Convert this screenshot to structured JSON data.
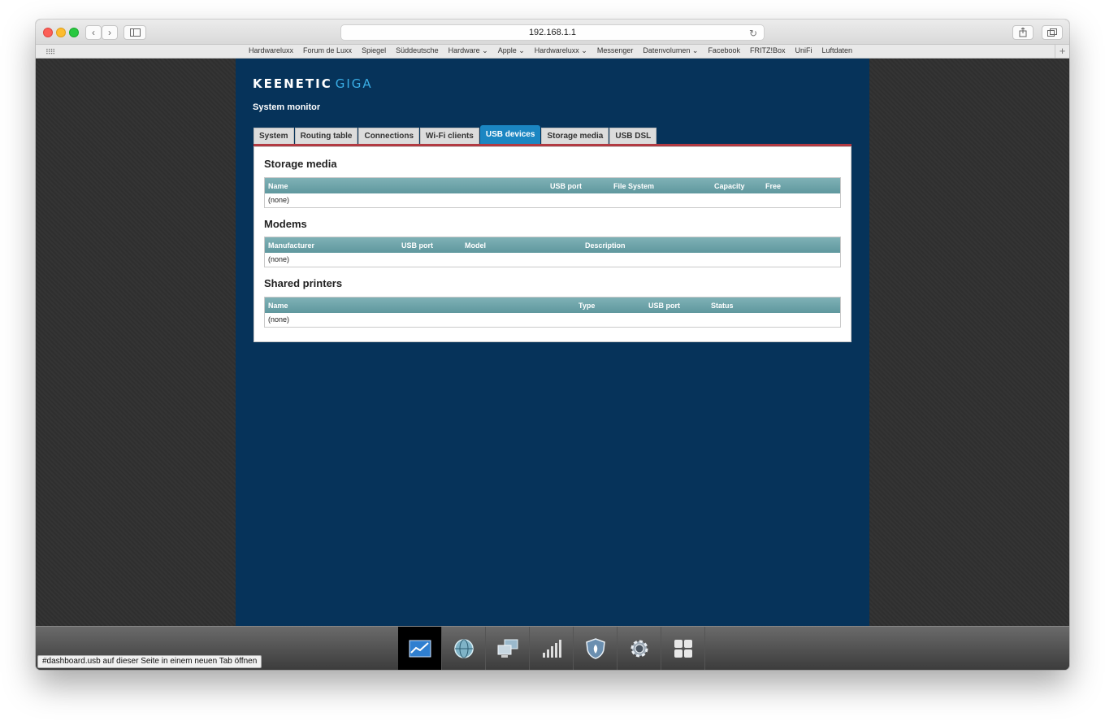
{
  "browser": {
    "url": "192.168.1.1",
    "favorites": [
      "Hardwareluxx",
      "Forum de Luxx",
      "Spiegel",
      "Süddeutsche",
      "Hardware ⌄",
      "Apple ⌄",
      "Hardwareluxx ⌄",
      "Messenger",
      "Datenvolumen ⌄",
      "Facebook",
      "FRITZ!Box",
      "UniFi",
      "Luftdaten"
    ],
    "status_link": "#dashboard.usb auf dieser Seite in einem neuen Tab öffnen"
  },
  "brand": {
    "name": "KEENETIC",
    "model": "GIGA"
  },
  "page_title": "System monitor",
  "tabs": [
    "System",
    "Routing table",
    "Connections",
    "Wi-Fi clients",
    "USB devices",
    "Storage media",
    "USB DSL"
  ],
  "active_tab": "USB devices",
  "sections": {
    "storage": {
      "title": "Storage media",
      "columns": [
        "Name",
        "USB port",
        "File System",
        "Capacity",
        "Free"
      ],
      "empty": "(none)"
    },
    "modems": {
      "title": "Modems",
      "columns": [
        "Manufacturer",
        "USB port",
        "Model",
        "Description"
      ],
      "empty": "(none)"
    },
    "printers": {
      "title": "Shared printers",
      "columns": [
        "Name",
        "Type",
        "USB port",
        "Status"
      ],
      "empty": "(none)"
    }
  },
  "dock": [
    "monitor-icon",
    "globe-icon",
    "network-computers-icon",
    "wifi-signal-icon",
    "shield-icon",
    "gear-icon",
    "apps-grid-icon"
  ]
}
